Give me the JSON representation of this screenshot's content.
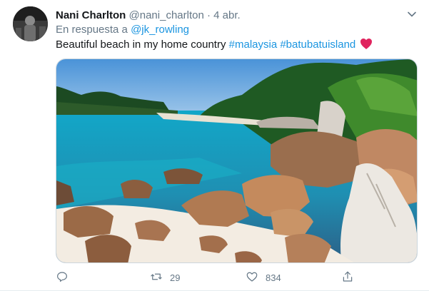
{
  "tweet": {
    "author_name": "Nani Charlton",
    "author_handle": "@nani_charlton",
    "separator": "·",
    "date": "4 abr.",
    "reply_prefix": "En respuesta a",
    "reply_mention": "@jk_rowling",
    "text": "Beautiful beach in my home country",
    "hashtags": [
      "#malaysia",
      "#batubatuisland"
    ],
    "emoji": "heart-emoji",
    "retweets": "29",
    "likes": "834"
  },
  "icons": {
    "menu": "chevron-down-icon",
    "reply": "reply-icon",
    "retweet": "retweet-icon",
    "like": "heart-outline-icon",
    "share": "share-icon"
  },
  "colors": {
    "link": "#1b95e0",
    "secondary_text": "#657786",
    "primary_text": "#14171a",
    "heart": "#e0245e"
  }
}
